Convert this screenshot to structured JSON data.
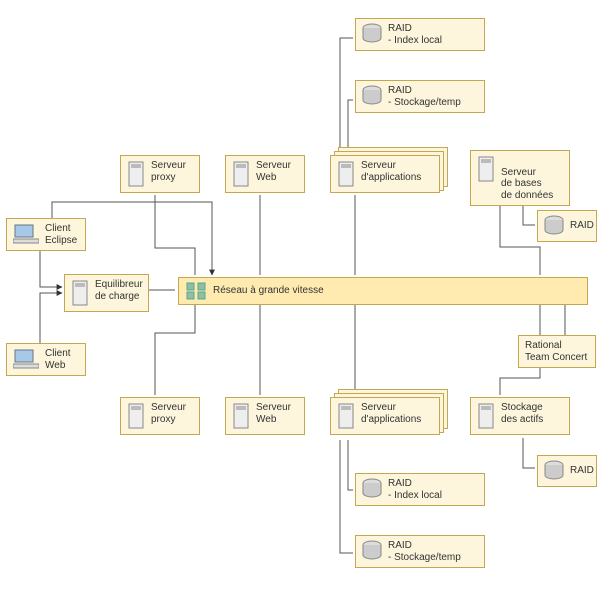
{
  "nodes": {
    "raid_idx_top": {
      "title": "RAID",
      "sub": "- Index local"
    },
    "raid_stg_top": {
      "title": "RAID",
      "sub": "- Stockage/temp"
    },
    "srv_proxy_top": {
      "title": "Serveur",
      "sub": "proxy"
    },
    "srv_web_top": {
      "title": "Serveur",
      "sub": "Web"
    },
    "srv_app_top": {
      "title": "Serveur",
      "sub": "d'applications"
    },
    "srv_db": {
      "title": "Serveur",
      "sub": "de bases\nde données"
    },
    "raid_db": {
      "title": "RAID",
      "sub": ""
    },
    "client_eclipse": {
      "title": "Client",
      "sub": "Eclipse"
    },
    "client_web": {
      "title": "Client",
      "sub": "Web"
    },
    "load_balancer": {
      "title": "Equilibreur",
      "sub": "de charge"
    },
    "hub": {
      "title": "Réseau à grande vitesse",
      "sub": ""
    },
    "rtc": {
      "title": "Rational\nTeam Concert",
      "sub": ""
    },
    "srv_proxy_bot": {
      "title": "Serveur",
      "sub": "proxy"
    },
    "srv_web_bot": {
      "title": "Serveur",
      "sub": "Web"
    },
    "srv_app_bot": {
      "title": "Serveur",
      "sub": "d'applications"
    },
    "storage_assets": {
      "title": "Stockage",
      "sub": "des actifs"
    },
    "raid_assets": {
      "title": "RAID",
      "sub": ""
    },
    "raid_idx_bot": {
      "title": "RAID",
      "sub": "- Index local"
    },
    "raid_stg_bot": {
      "title": "RAID",
      "sub": "- Stockage/temp"
    }
  },
  "icons": {
    "disk": "disk-icon",
    "server": "server-icon",
    "client": "client-icon",
    "hub": "hub-icon"
  }
}
